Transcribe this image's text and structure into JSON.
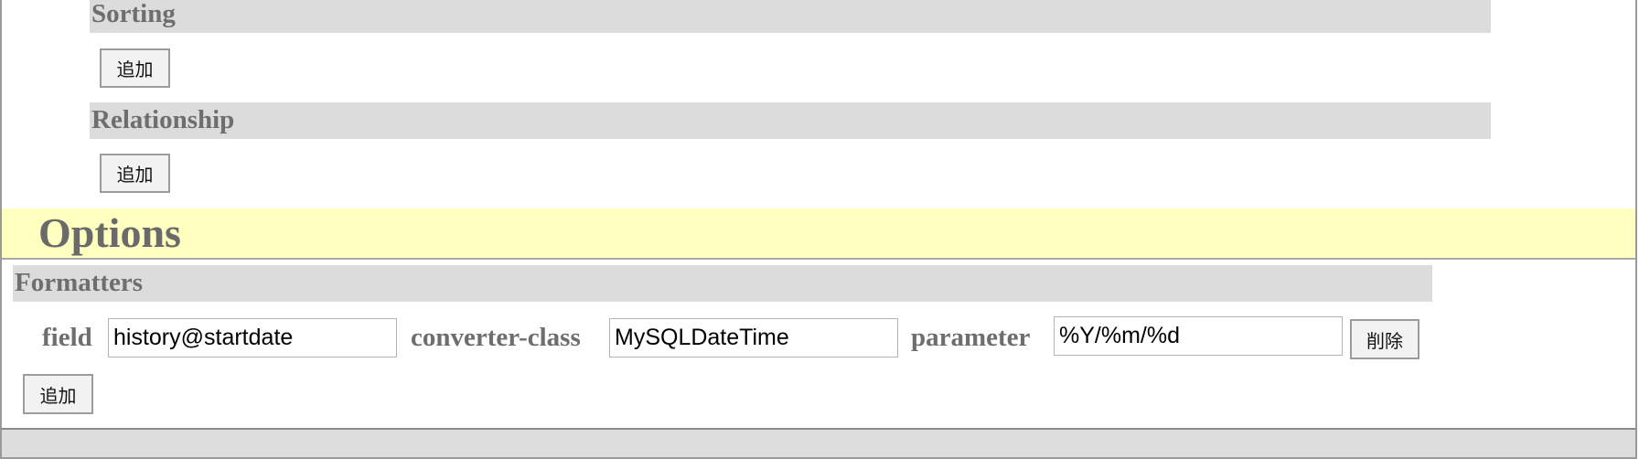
{
  "sections": {
    "sorting": {
      "title": "Sorting",
      "add_label": "追加"
    },
    "relationship": {
      "title": "Relationship",
      "add_label": "追加"
    }
  },
  "options": {
    "title": "Options",
    "formatters": {
      "title": "Formatters",
      "row": {
        "field_label": "field",
        "field_value": "history@startdate",
        "converter_label": "converter-class",
        "converter_value": "MySQLDateTime",
        "parameter_label": "parameter",
        "parameter_value": "%Y/%m/%d",
        "delete_label": "削除"
      },
      "add_label": "追加"
    }
  },
  "colors": {
    "section_header_bg": "#dcdcdc",
    "options_bar_bg": "#ffffc0",
    "heading_text": "#6e6e6e"
  }
}
